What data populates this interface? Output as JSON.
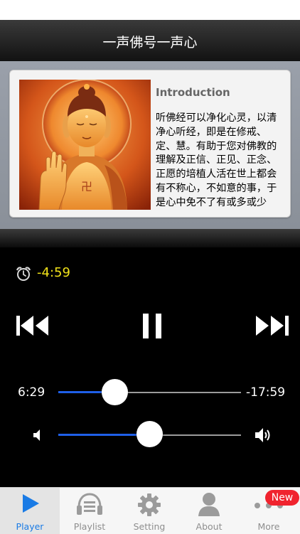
{
  "nav": {
    "title": "一声佛号一声心"
  },
  "intro": {
    "heading": "Introduction",
    "text": "听佛经可以净化心灵，以清净心听经，即是在修戒、定、慧。有助于您对佛教的理解及正信、正见、正念、正愿的培植人活在世上都会有不称心，不如意的事，于是心中免不了有或多或少"
  },
  "timer": {
    "remaining": "-4:59"
  },
  "player": {
    "elapsed": "6:29",
    "remaining": "-17:59",
    "progress": 0.31,
    "volume": 0.5
  },
  "tabs": [
    {
      "label": "Player",
      "icon": "play-icon",
      "active": true
    },
    {
      "label": "Playlist",
      "icon": "playlist-icon",
      "active": false
    },
    {
      "label": "Setting",
      "icon": "gear-icon",
      "active": false
    },
    {
      "label": "About",
      "icon": "person-icon",
      "active": false
    },
    {
      "label": "More",
      "icon": "more-icon",
      "active": false
    }
  ],
  "badge": {
    "label": "New"
  },
  "colors": {
    "accent": "#1f5fe8",
    "timer": "#f1e21a",
    "badge": "#f0232e",
    "tab_active": "#1a7be5"
  }
}
